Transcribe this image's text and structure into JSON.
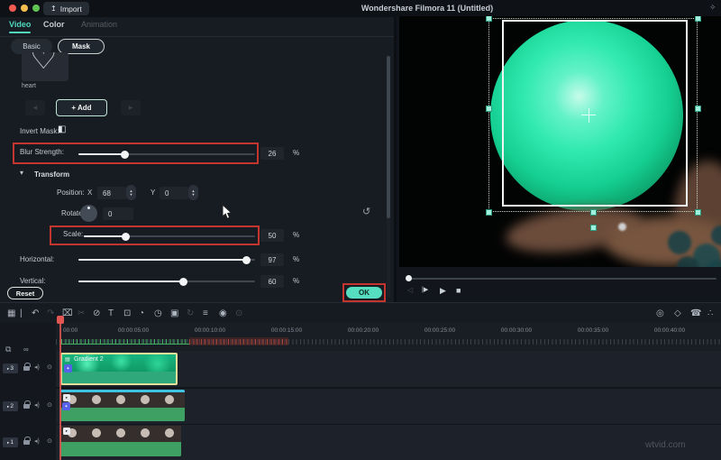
{
  "titlebar": {
    "title": "Wondershare Filmora 11 (Untitled)",
    "import_label": "Import",
    "import_icon": "↥",
    "bulb_icon": "✧"
  },
  "panel": {
    "tabs": [
      {
        "label": "Video"
      },
      {
        "label": "Color"
      },
      {
        "label": "Animation"
      }
    ],
    "subtabs": [
      {
        "label": "Basic"
      },
      {
        "label": "Mask"
      }
    ],
    "mask": {
      "shape_glyph": "♡",
      "shape_label": "heart",
      "add_label": "+ Add",
      "prev_glyph": "◀",
      "next_glyph": "▶",
      "invert_label": "Invert Mask:",
      "invert_icon": "◧"
    },
    "rows": {
      "blur": {
        "label": "Blur Strength:",
        "value": "26",
        "unit": "%"
      },
      "transform_label": "Transform",
      "transform_chevron": "▾",
      "position": {
        "label": "Position:",
        "x_label": "X",
        "x_value": "68",
        "y_label": "Y",
        "y_value": "0"
      },
      "rotate": {
        "label": "Rotate:",
        "value": "0",
        "reset_icon": "↺"
      },
      "scale": {
        "label": "Scale:",
        "value": "50",
        "unit": "%"
      },
      "horizontal": {
        "label": "Horizontal:",
        "value": "97",
        "unit": "%"
      },
      "vertical": {
        "label": "Vertical:",
        "value": "60",
        "unit": "%"
      }
    },
    "reset_label": "Reset",
    "ok_label": "OK"
  },
  "preview": {
    "controls": [
      {
        "name": "mute-icon",
        "glyph": "◁"
      },
      {
        "name": "frame-step-icon",
        "glyph": "|▶"
      },
      {
        "name": "play-icon",
        "glyph": "▶"
      },
      {
        "name": "stop-icon",
        "glyph": "■"
      }
    ]
  },
  "timeline": {
    "toolbar": [
      {
        "name": "snap-icon",
        "glyph": "▦",
        "dim": false
      },
      {
        "name": "add-marker-icon",
        "glyph": "|",
        "dim": false
      },
      {
        "name": "undo-icon",
        "glyph": "↶",
        "dim": false
      },
      {
        "name": "redo-icon",
        "glyph": "↷",
        "dim": true
      },
      {
        "name": "delete-icon",
        "glyph": "⌧",
        "dim": false
      },
      {
        "name": "split-icon",
        "glyph": "✂",
        "dim": true
      },
      {
        "name": "attach-icon",
        "glyph": "⊘",
        "dim": false
      },
      {
        "name": "text-tool-icon",
        "glyph": "T",
        "dim": false
      },
      {
        "name": "crop-icon",
        "glyph": "⊡",
        "dim": false
      },
      {
        "name": "pan-zoom-icon",
        "glyph": "◔",
        "dim": false
      },
      {
        "name": "speed-icon",
        "glyph": "◷",
        "dim": false
      },
      {
        "name": "green-screen-icon",
        "glyph": "▣",
        "dim": false
      },
      {
        "name": "motion-tracking-icon",
        "glyph": "↻",
        "dim": true
      },
      {
        "name": "mixer-icon",
        "glyph": "≡",
        "dim": false
      },
      {
        "name": "record-icon",
        "glyph": "◉",
        "dim": false
      },
      {
        "name": "snapshot-icon",
        "glyph": "⊙",
        "dim": true
      }
    ],
    "toolbar_right": [
      {
        "name": "render-preview-icon",
        "glyph": "◎"
      },
      {
        "name": "shield-icon",
        "glyph": "◇"
      },
      {
        "name": "phone-icon",
        "glyph": "☎"
      },
      {
        "name": "share-icon",
        "glyph": "∴"
      }
    ],
    "header_icons": {
      "copy": "⧉",
      "link": "∞",
      "track_type": "▸",
      "speaker": "◂)",
      "eye": "⊙"
    },
    "ruler_labels": [
      "00:00",
      "00:00:05:00",
      "00:00:10:00",
      "00:00:15:00",
      "00:00:20:00",
      "00:00:25:00",
      "00:00:30:00",
      "00:00:35:00",
      "00:00:40:00"
    ],
    "tracks": [
      {
        "number": "3",
        "clip_label": "Gradient 2"
      },
      {
        "number": "2",
        "clip_label": ""
      },
      {
        "number": "1",
        "clip_label": ""
      }
    ]
  },
  "watermark": "wtvid.com",
  "colors": {
    "accent_teal": "#55dfc0",
    "annotation_red": "#c5352f",
    "clip_green": "#3fa063",
    "selection_yellow": "#e4df9a",
    "cyan_strip": "#3fc2e2",
    "orb_teal": "#2fe9ae"
  }
}
